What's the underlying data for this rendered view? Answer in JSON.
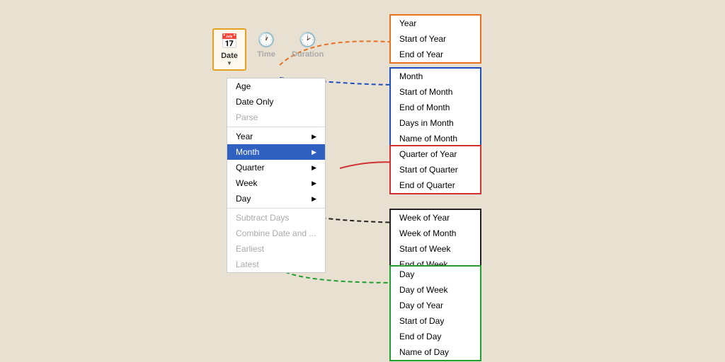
{
  "toolbar": {
    "buttons": [
      {
        "label": "Date",
        "icon": "📅",
        "active": true
      },
      {
        "label": "Time",
        "icon": "🕐",
        "active": false
      },
      {
        "label": "Duration",
        "icon": "🕑",
        "active": false
      }
    ]
  },
  "dropdown": {
    "items": [
      {
        "label": "Age",
        "type": "item"
      },
      {
        "label": "Date Only",
        "type": "item"
      },
      {
        "label": "Parse",
        "type": "disabled"
      },
      {
        "label": "Year",
        "type": "submenu"
      },
      {
        "label": "Month",
        "type": "submenu",
        "highlighted": true
      },
      {
        "label": "Quarter",
        "type": "submenu"
      },
      {
        "label": "Week",
        "type": "submenu"
      },
      {
        "label": "Day",
        "type": "submenu"
      },
      {
        "label": "Subtract Days",
        "type": "disabled"
      },
      {
        "label": "Combine Date and ...",
        "type": "disabled"
      },
      {
        "label": "Earliest",
        "type": "disabled"
      },
      {
        "label": "Latest",
        "type": "disabled"
      }
    ]
  },
  "submenu_year": {
    "items": [
      "Year",
      "Start of Year",
      "End of Year"
    ]
  },
  "submenu_month": {
    "items": [
      "Month",
      "Start of Month",
      "End of Month",
      "Days in Month",
      "Name of Month"
    ]
  },
  "submenu_quarter": {
    "items": [
      "Quarter of Year",
      "Start of Quarter",
      "End of Quarter"
    ]
  },
  "submenu_week": {
    "items": [
      "Week of Year",
      "Week of Month",
      "Start of Week",
      "End of Week"
    ]
  },
  "submenu_day": {
    "items": [
      "Day",
      "Day of Week",
      "Day of Year",
      "Start of Day",
      "End of Day",
      "Name of Day"
    ]
  }
}
